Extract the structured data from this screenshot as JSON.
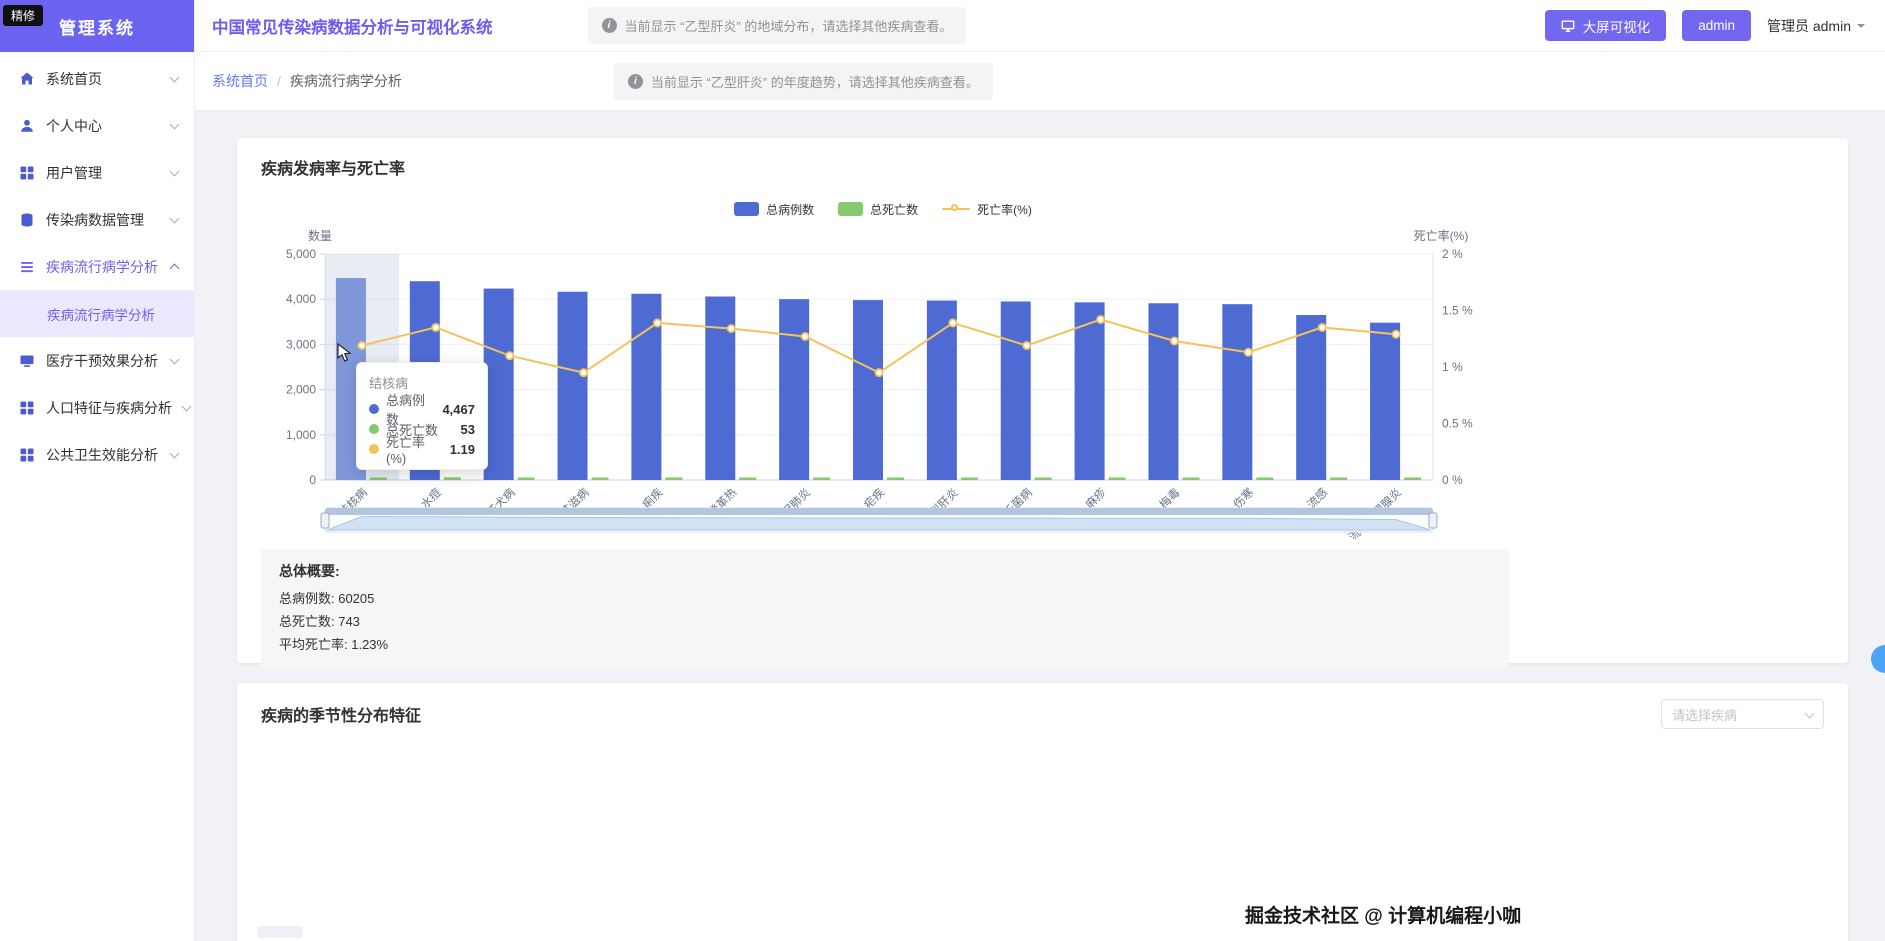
{
  "badge": "精修",
  "sidebar": {
    "brand": "管理系统",
    "items": [
      "系统首页",
      "个人中心",
      "用户管理",
      "传染病数据管理",
      "疾病流行病学分析",
      "医疗干预效果分析",
      "人口特征与疾病分析",
      "公共卫生效能分析"
    ],
    "submenu_active": "疾病流行病学分析"
  },
  "header": {
    "title": "中国常见传染病数据分析与可视化系统",
    "banner": "当前显示 “乙型肝炎” 的地域分布，请选择其他疾病查看。",
    "big_screen_btn": "大屏可视化",
    "admin_btn": "admin",
    "user_label": "管理员 admin"
  },
  "breadcrumb": {
    "home": "系统首页",
    "sep": "/",
    "current": "疾病流行病学分析",
    "banner": "当前显示 “乙型肝炎” 的年度趋势，请选择其他疾病查看。"
  },
  "card1": {
    "title": "疾病发病率与死亡率",
    "summary_title": "总体概要:",
    "summary_lines": [
      "总病例数: 60205",
      "总死亡数: 743",
      "平均死亡率: 1.23%"
    ]
  },
  "tooltip": {
    "title": "结核病",
    "rows": [
      {
        "label": "总病例数",
        "value": "4,467",
        "color": "#4d6bd3"
      },
      {
        "label": "总死亡数",
        "value": "53",
        "color": "#86c96f"
      },
      {
        "label": "死亡率(%)",
        "value": "1.19",
        "color": "#f3c25a"
      }
    ]
  },
  "card2": {
    "title": "疾病的季节性分布特征",
    "select_placeholder": "请选择疾病"
  },
  "watermark": "掘金技术社区 @ 计算机编程小咖",
  "theme": {
    "accent": "#6c63f0",
    "bar_hover": "#8097da",
    "hover_band": "rgba(110,135,180,0.16)"
  },
  "chart_data": {
    "type": "bar",
    "title": "疾病发病率与死亡率",
    "legend_position": "top-center",
    "grid": true,
    "categories": [
      "结核病",
      "水痘",
      "狂犬病",
      "艾滋病",
      "痢疾",
      "登革热",
      "新冠肺炎",
      "疟疾",
      "乙型肝炎",
      "布鲁氏菌病",
      "麻疹",
      "梅毒",
      "伤寒",
      "流感",
      "流行性腮腺炎"
    ],
    "series": [
      {
        "name": "总病例数",
        "type": "bar",
        "color": "#4d6bd3",
        "axis": "left",
        "values": [
          4467,
          4398,
          4235,
          4165,
          4120,
          4060,
          4000,
          3980,
          3970,
          3950,
          3930,
          3910,
          3890,
          3650,
          3480
        ]
      },
      {
        "name": "总死亡数",
        "type": "bar",
        "color": "#86c96f",
        "axis": "left",
        "values": [
          53,
          59,
          47,
          40,
          57,
          54,
          51,
          38,
          55,
          47,
          56,
          48,
          44,
          49,
          45
        ]
      },
      {
        "name": "死亡率(%)",
        "type": "line",
        "color": "#f3c25a",
        "axis": "right",
        "values": [
          1.19,
          1.35,
          1.1,
          0.95,
          1.39,
          1.34,
          1.27,
          0.95,
          1.39,
          1.19,
          1.42,
          1.23,
          1.13,
          1.35,
          1.29
        ]
      }
    ],
    "ylabel_left": "数量",
    "ylabel_right": "死亡率(%)",
    "yaxis_left": {
      "min": 0,
      "max": 5000,
      "ticks": [
        "5,000",
        "4,000",
        "3,000",
        "2,000",
        "1,000",
        "0"
      ]
    },
    "yaxis_right": {
      "min": 0,
      "max": 2,
      "ticks": [
        "2 %",
        "1.5 %",
        "1 %",
        "0.5 %",
        "0 %"
      ]
    },
    "datazoom": true,
    "hover_category": "结核病"
  }
}
